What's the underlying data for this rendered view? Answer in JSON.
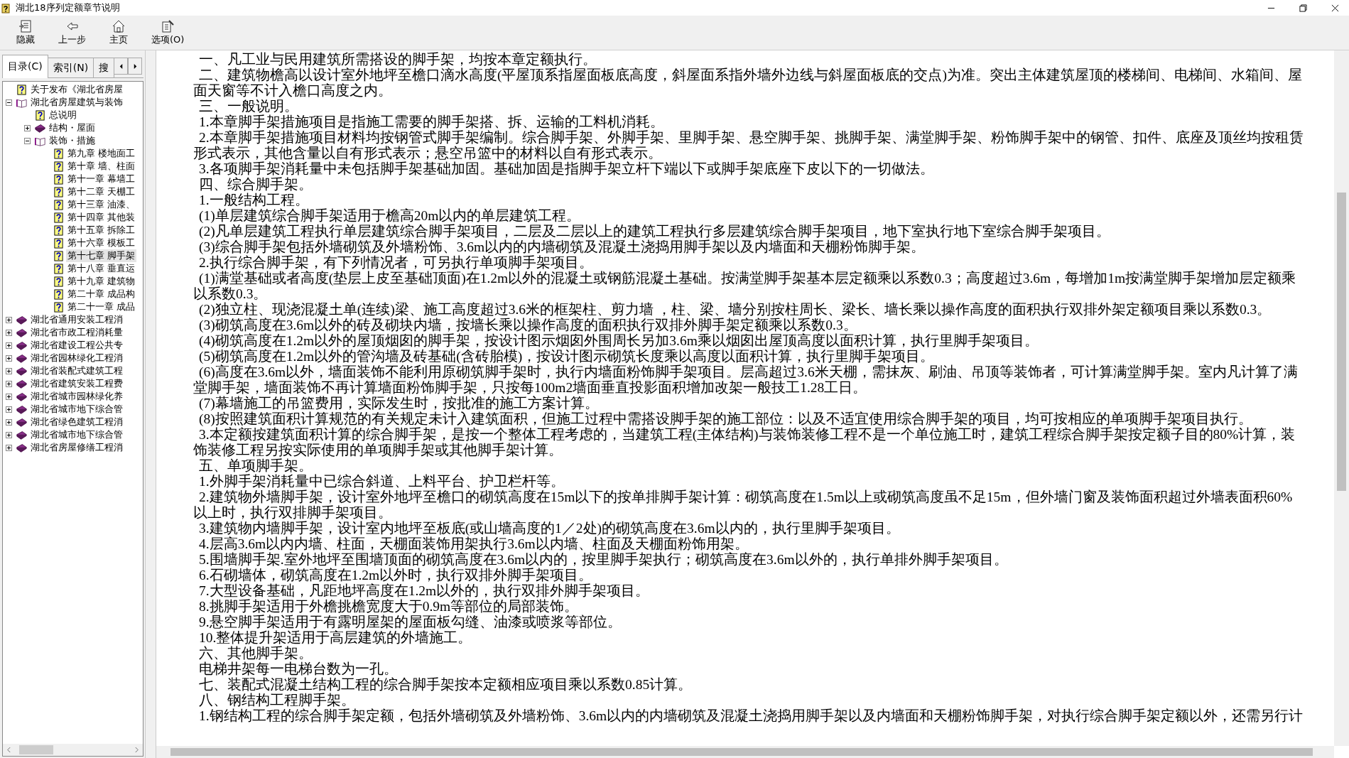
{
  "window": {
    "title": "湖北18序列定额章节说明"
  },
  "toolbar": [
    {
      "label": "隐藏"
    },
    {
      "label": "上一步"
    },
    {
      "label": "主页"
    },
    {
      "label": "选项(O)"
    }
  ],
  "tabs": [
    {
      "label": "目录(C)",
      "selected": true
    },
    {
      "label": "索引(N)",
      "selected": false
    },
    {
      "label": "搜",
      "selected": false
    }
  ],
  "tree": [
    {
      "label": "关于发布《湖北省房屋",
      "kind": "page",
      "selected": false
    },
    {
      "label": "湖北省房屋建筑与装饰",
      "kind": "book",
      "expanded": true,
      "selected": false,
      "children": [
        {
          "label": "总说明",
          "kind": "page",
          "selected": false
        },
        {
          "label": "结构・屋面",
          "kind": "book",
          "expanded": false,
          "selected": false
        },
        {
          "label": "装饰・措施",
          "kind": "book",
          "expanded": true,
          "selected": false,
          "children": [
            {
              "label": "第九章  楼地面工",
              "kind": "page",
              "selected": false
            },
            {
              "label": "第十章  墙、柱面",
              "kind": "page",
              "selected": false
            },
            {
              "label": "第十一章  幕墙工",
              "kind": "page",
              "selected": false
            },
            {
              "label": "第十二章  天棚工",
              "kind": "page",
              "selected": false
            },
            {
              "label": "第十三章  油漆、",
              "kind": "page",
              "selected": false
            },
            {
              "label": "第十四章  其他装",
              "kind": "page",
              "selected": false
            },
            {
              "label": "第十五章  拆除工",
              "kind": "page",
              "selected": false
            },
            {
              "label": "第十六章  模板工",
              "kind": "page",
              "selected": false
            },
            {
              "label": "第十七章  脚手架",
              "kind": "page",
              "selected": true
            },
            {
              "label": "第十八章  垂直运",
              "kind": "page",
              "selected": false
            },
            {
              "label": "第十九章  建筑物",
              "kind": "page",
              "selected": false
            },
            {
              "label": "第二十章  成品构",
              "kind": "page",
              "selected": false
            },
            {
              "label": "第二十一章  成品",
              "kind": "page",
              "selected": false
            }
          ]
        }
      ]
    },
    {
      "label": "湖北省通用安装工程消",
      "kind": "book",
      "expanded": false,
      "selected": false
    },
    {
      "label": "湖北省市政工程消耗量",
      "kind": "book",
      "expanded": false,
      "selected": false
    },
    {
      "label": "湖北省建设工程公共专",
      "kind": "book",
      "expanded": false,
      "selected": false
    },
    {
      "label": "湖北省园林绿化工程消",
      "kind": "book",
      "expanded": false,
      "selected": false
    },
    {
      "label": "湖北省装配式建筑工程",
      "kind": "book",
      "expanded": false,
      "selected": false
    },
    {
      "label": "湖北省建筑安装工程费",
      "kind": "book",
      "expanded": false,
      "selected": false
    },
    {
      "label": "湖北省城市园林绿化养",
      "kind": "book",
      "expanded": false,
      "selected": false
    },
    {
      "label": "湖北省城市地下综合管",
      "kind": "book",
      "expanded": false,
      "selected": false
    },
    {
      "label": "湖北省绿色建筑工程消",
      "kind": "book",
      "expanded": false,
      "selected": false
    },
    {
      "label": "湖北省城市地下综合管",
      "kind": "book",
      "expanded": false,
      "selected": false
    },
    {
      "label": "湖北省房屋修缮工程消",
      "kind": "book",
      "expanded": false,
      "selected": false
    }
  ],
  "content": [
    "一、凡工业与民用建筑所需搭设的脚手架，均按本章定额执行。",
    "二、建筑物檐高以设计室外地坪至檐口滴水高度(平屋顶系指屋面板底高度，斜屋面系指外墙外边线与斜屋面板底的交点)为准。突出主体建筑屋顶的楼梯间、电梯间、水箱间、屋面天窗等不计入檐口高度之内。",
    "三、一般说明。",
    "1.本章脚手架措施项目是指施工需要的脚手架搭、拆、运输的工料机消耗。",
    "2.本章脚手架措施项目材料均按钢管式脚手架编制。综合脚手架、外脚手架、里脚手架、悬空脚手架、挑脚手架、满堂脚手架、粉饰脚手架中的钢管、扣件、底座及顶丝均按租赁形式表示，其他含量以自有形式表示；悬空吊篮中的材料以自有形式表示。",
    "3.各项脚手架消耗量中未包括脚手架基础加固。基础加固是指脚手架立杆下端以下或脚手架底座下皮以下的一切做法。",
    "四、综合脚手架。",
    "1.一般结构工程。",
    "(1)单层建筑综合脚手架适用于檐高20m以内的单层建筑工程。",
    "(2)凡单层建筑工程执行单层建筑综合脚手架项目，二层及二层以上的建筑工程执行多层建筑综合脚手架项目，地下室执行地下室综合脚手架项目。",
    "(3)综合脚手架包括外墙砌筑及外墙粉饰、3.6m以内的内墙砌筑及混凝土浇捣用脚手架以及内墙面和天棚粉饰脚手架。",
    "2.执行综合脚手架，有下列情况者，可另执行单项脚手架项目。",
    "(1)满堂基础或者高度(垫层上皮至基础顶面)在1.2m以外的混凝土或钢筋混凝土基础。按满堂脚手架基本层定额乘以系数0.3；高度超过3.6m，每增加1m按满堂脚手架增加层定额乘以系数0.3。",
    "(2)独立柱、现浇混凝土单(连续)梁、施工高度超过3.6米的框架柱、剪力墙 ，柱、梁、墙分别按柱周长、梁长、墙长乘以操作高度的面积执行双排外架定额项目乘以系数0.3。",
    "(3)砌筑高度在3.6m以外的砖及砌块内墙，按墙长乘以操作高度的面积执行双排外脚手架定额乘以系数0.3。",
    "(4)砌筑高度在1.2m以外的屋顶烟囱的脚手架，按设计图示烟囱外围周长另加3.6m乘以烟囱出屋顶高度以面积计算，执行里脚手架项目。",
    "(5)砌筑高度在1.2m以外的管沟墙及砖基础(含砖胎模)，按设计图示砌筑长度乘以高度以面积计算，执行里脚手架项目。",
    "(6)高度在3.6m以外，墙面装饰不能利用原砌筑脚手架时，执行内墙面粉饰脚手架项目。层高超过3.6米天棚，需抹灰、刷油、吊顶等装饰者，可计算满堂脚手架。室内凡计算了满堂脚手架，墙面装饰不再计算墙面粉饰脚手架，只按每100m2墙面垂直投影面积增加改架一般技工1.28工日。",
    "(7)幕墙施工的吊篮费用，实际发生时，按批准的施工方案计算。",
    "(8)按照建筑面积计算规范的有关规定未计入建筑面积，但施工过程中需搭设脚手架的施工部位：以及不适宜使用综合脚手架的项目，均可按相应的单项脚手架项目执行。",
    "3.本定额按建筑面积计算的综合脚手架，是按一个整体工程考虑的，当建筑工程(主体结构)与装饰装修工程不是一个单位施工时，建筑工程综合脚手架按定额子目的80%计算，装饰装修工程另按实际使用的单项脚手架或其他脚手架计算。",
    "五、单项脚手架。",
    "1.外脚手架消耗量中已综合斜道、上料平台、护卫栏杆等。",
    "2.建筑物外墙脚手架，设计室外地坪至檐口的砌筑高度在15m以下的按单排脚手架计算：砌筑高度在1.5m以上或砌筑高度虽不足15m，但外墙门窗及装饰面积超过外墙表面积60%以上时，执行双排脚手架项目。",
    "3.建筑物内墙脚手架，设计室内地坪至板底(或山墙高度的1／2处)的砌筑高度在3.6m以内的，执行里脚手架项目。",
    "4.层高3.6m以内内墙、柱面，天棚面装饰用架执行3.6m以内墙、柱面及天棚面粉饰用架。",
    "5.围墙脚手架.室外地坪至围墙顶面的砌筑高度在3.6m以内的，按里脚手架执行；砌筑高度在3.6m以外的，执行单排外脚手架项目。",
    "6.石砌墙体，砌筑高度在1.2m以外时，执行双排外脚手架项目。",
    "7.大型设备基础，凡距地坪高度在1.2m以外的，执行双排外脚手架项目。",
    "8.挑脚手架适用于外檐挑檐宽度大于0.9m等部位的局部装饰。",
    "9.悬空脚手架适用于有露明屋架的屋面板勾缝、油漆或喷浆等部位。",
    "10.整体提升架适用于高层建筑的外墙施工。",
    "六、其他脚手架。",
    "电梯井架每一电梯台数为一孔。",
    "七、装配式混凝土结构工程的综合脚手架按本定额相应项目乘以系数0.85计算。",
    "八、钢结构工程脚手架。",
    "1.钢结构工程的综合脚手架定额，包括外墙砌筑及外墙粉饰、3.6m以内的内墙砌筑及混凝土浇捣用脚手架以及内墙面和天棚粉饰脚手架，对执行综合脚手架定额以外，还需另行计"
  ]
}
